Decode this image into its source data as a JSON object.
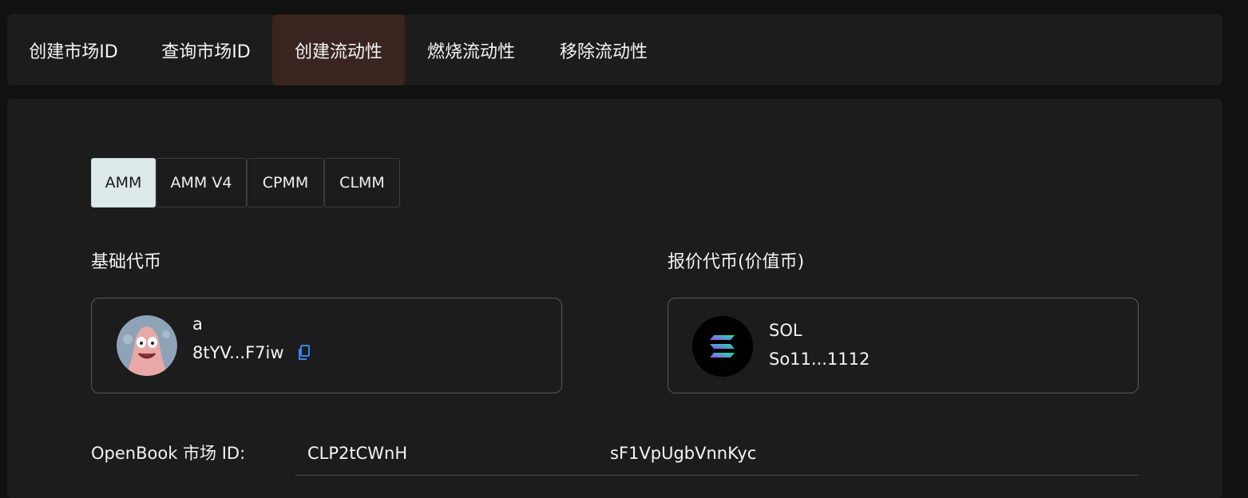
{
  "nav": {
    "tabs": [
      {
        "label": "创建市场ID",
        "active": false
      },
      {
        "label": "查询市场ID",
        "active": false
      },
      {
        "label": "创建流动性",
        "active": true
      },
      {
        "label": "燃烧流动性",
        "active": false
      },
      {
        "label": "移除流动性",
        "active": false
      }
    ]
  },
  "pool_types": [
    {
      "label": "AMM",
      "active": true
    },
    {
      "label": "AMM V4",
      "active": false
    },
    {
      "label": "CPMM",
      "active": false
    },
    {
      "label": "CLMM",
      "active": false
    }
  ],
  "base_token": {
    "section_label": "基础代币",
    "symbol": "a",
    "address": "8tYV...F7iw",
    "icon": "patrick-avatar-icon"
  },
  "quote_token": {
    "section_label": "报价代币(价值币)",
    "symbol": "SOL",
    "address": "So11...1112",
    "icon": "solana-logo-icon"
  },
  "market_id": {
    "label": "OpenBook 市场 ID:",
    "value": "CLP2tCWnH                   sF1VpUgbVnnKyc"
  },
  "colors": {
    "accent_active_tab": "#3a2420",
    "active_segment": "#dde9ea",
    "copy_icon": "#3b82f6"
  }
}
